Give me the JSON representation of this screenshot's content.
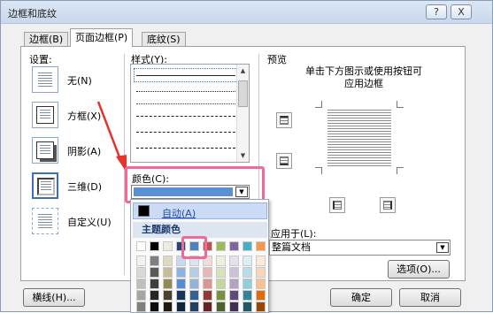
{
  "window": {
    "title": "边框和底纹",
    "help_button": "?",
    "close_button": "X"
  },
  "tabs": [
    {
      "label": "边框(B)"
    },
    {
      "label": "页面边框(P)"
    },
    {
      "label": "底纹(S)"
    }
  ],
  "settings": {
    "header": "设置:",
    "items": [
      {
        "label": "无(N)"
      },
      {
        "label": "方框(X)"
      },
      {
        "label": "阴影(A)"
      },
      {
        "label": "三维(D)"
      },
      {
        "label": "自定义(U)"
      }
    ]
  },
  "style": {
    "header": "样式(Y):"
  },
  "color": {
    "label": "颜色(C):",
    "selected_color": "#5b8fd0",
    "popup": {
      "automatic_label": "自动(A)",
      "theme_colors_header": "主题颜色",
      "top_row": [
        "#ffffff",
        "#000000",
        "#eeece1",
        "#1f497d",
        "#4f81bd",
        "#c0504d",
        "#9bbb59",
        "#8064a2",
        "#4bacc6",
        "#f79646"
      ],
      "shade_columns": [
        [
          "#f2f2f2",
          "#d8d8d8",
          "#bfbfbf",
          "#a5a5a5",
          "#7f7f7f"
        ],
        [
          "#7f7f7f",
          "#595959",
          "#3f3f3f",
          "#262626",
          "#0c0c0c"
        ],
        [
          "#ddd9c3",
          "#c4bd97",
          "#938953",
          "#494429",
          "#1d1b10"
        ],
        [
          "#c6d9f0",
          "#8db3e2",
          "#548dd4",
          "#17365d",
          "#0f243e"
        ],
        [
          "#dbe5f1",
          "#b8cce4",
          "#95b3d7",
          "#366092",
          "#244061"
        ],
        [
          "#f2dcdb",
          "#e5b9b7",
          "#d99694",
          "#953734",
          "#632423"
        ],
        [
          "#ebf1dd",
          "#d7e3bc",
          "#c3d69b",
          "#76923c",
          "#4f6128"
        ],
        [
          "#e5e0ec",
          "#ccc1d9",
          "#b2a2c7",
          "#5f497a",
          "#3f3151"
        ],
        [
          "#dbeef3",
          "#b7dde8",
          "#92cddc",
          "#31859b",
          "#205867"
        ],
        [
          "#fdeada",
          "#fbd5b5",
          "#fac08f",
          "#e36c09",
          "#974806"
        ]
      ]
    }
  },
  "preview": {
    "header": "预览",
    "instruction": "单击下方图示或使用按钮可应用边框"
  },
  "apply_to": {
    "label": "应用于(L):",
    "value": "整篇文档"
  },
  "buttons": {
    "horizontal_line": "横线(H)...",
    "options": "选项(O)...",
    "ok": "确定",
    "cancel": "取消"
  },
  "highlight_color": "#f06a98"
}
